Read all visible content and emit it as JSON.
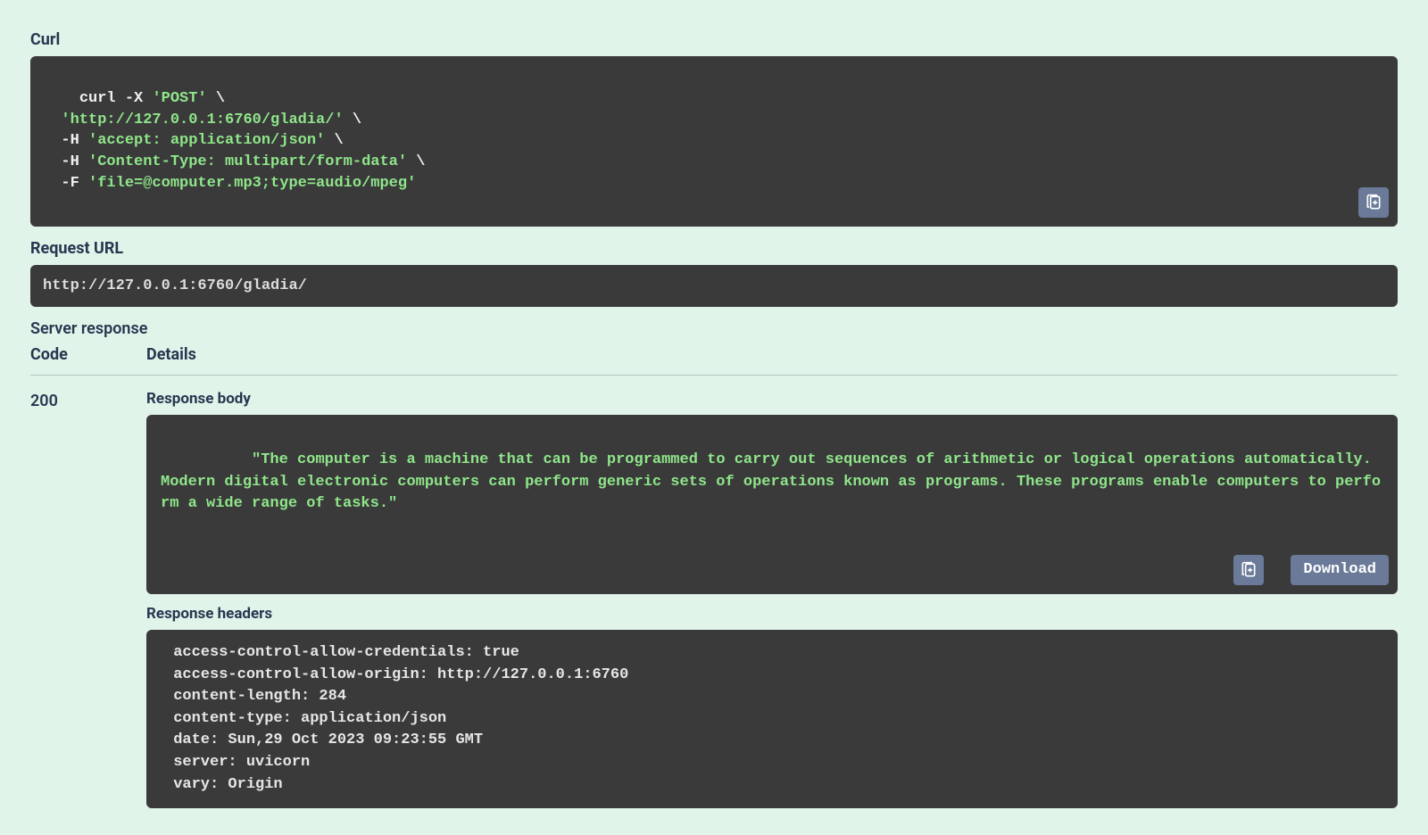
{
  "curl": {
    "heading": "Curl",
    "lines": [
      {
        "prefix": "curl -X ",
        "q": "'POST'",
        "suffix": " \\"
      },
      {
        "prefix": "  ",
        "q": "'http://127.0.0.1:6760/gladia/'",
        "suffix": " \\"
      },
      {
        "prefix": "  -H ",
        "q": "'accept: application/json'",
        "suffix": " \\"
      },
      {
        "prefix": "  -H ",
        "q": "'Content-Type: multipart/form-data'",
        "suffix": " \\"
      },
      {
        "prefix": "  -F ",
        "q": "'file=@computer.mp3;type=audio/mpeg'",
        "suffix": ""
      }
    ]
  },
  "request_url": {
    "heading": "Request URL",
    "value": "http://127.0.0.1:6760/gladia/"
  },
  "server_response": {
    "heading": "Server response",
    "columns": {
      "code": "Code",
      "details": "Details"
    },
    "code": "200",
    "body_heading": "Response body",
    "body": "\"The computer is a machine that can be programmed to carry out sequences of arithmetic or logical operations automatically. Modern digital electronic computers can perform generic sets of operations known as programs. These programs enable computers to perform a wide range of tasks.\"",
    "download_label": "Download",
    "headers_heading": "Response headers",
    "headers": [
      {
        "k": "access-control-allow-credentials",
        "v": "true"
      },
      {
        "k": "access-control-allow-origin",
        "v": "http://127.0.0.1:6760"
      },
      {
        "k": "content-length",
        "v": "284"
      },
      {
        "k": "content-type",
        "v": "application/json"
      },
      {
        "k": "date",
        "v": "Sun,29 Oct 2023 09:23:55 GMT"
      },
      {
        "k": "server",
        "v": "uvicorn"
      },
      {
        "k": "vary",
        "v": "Origin"
      }
    ]
  }
}
